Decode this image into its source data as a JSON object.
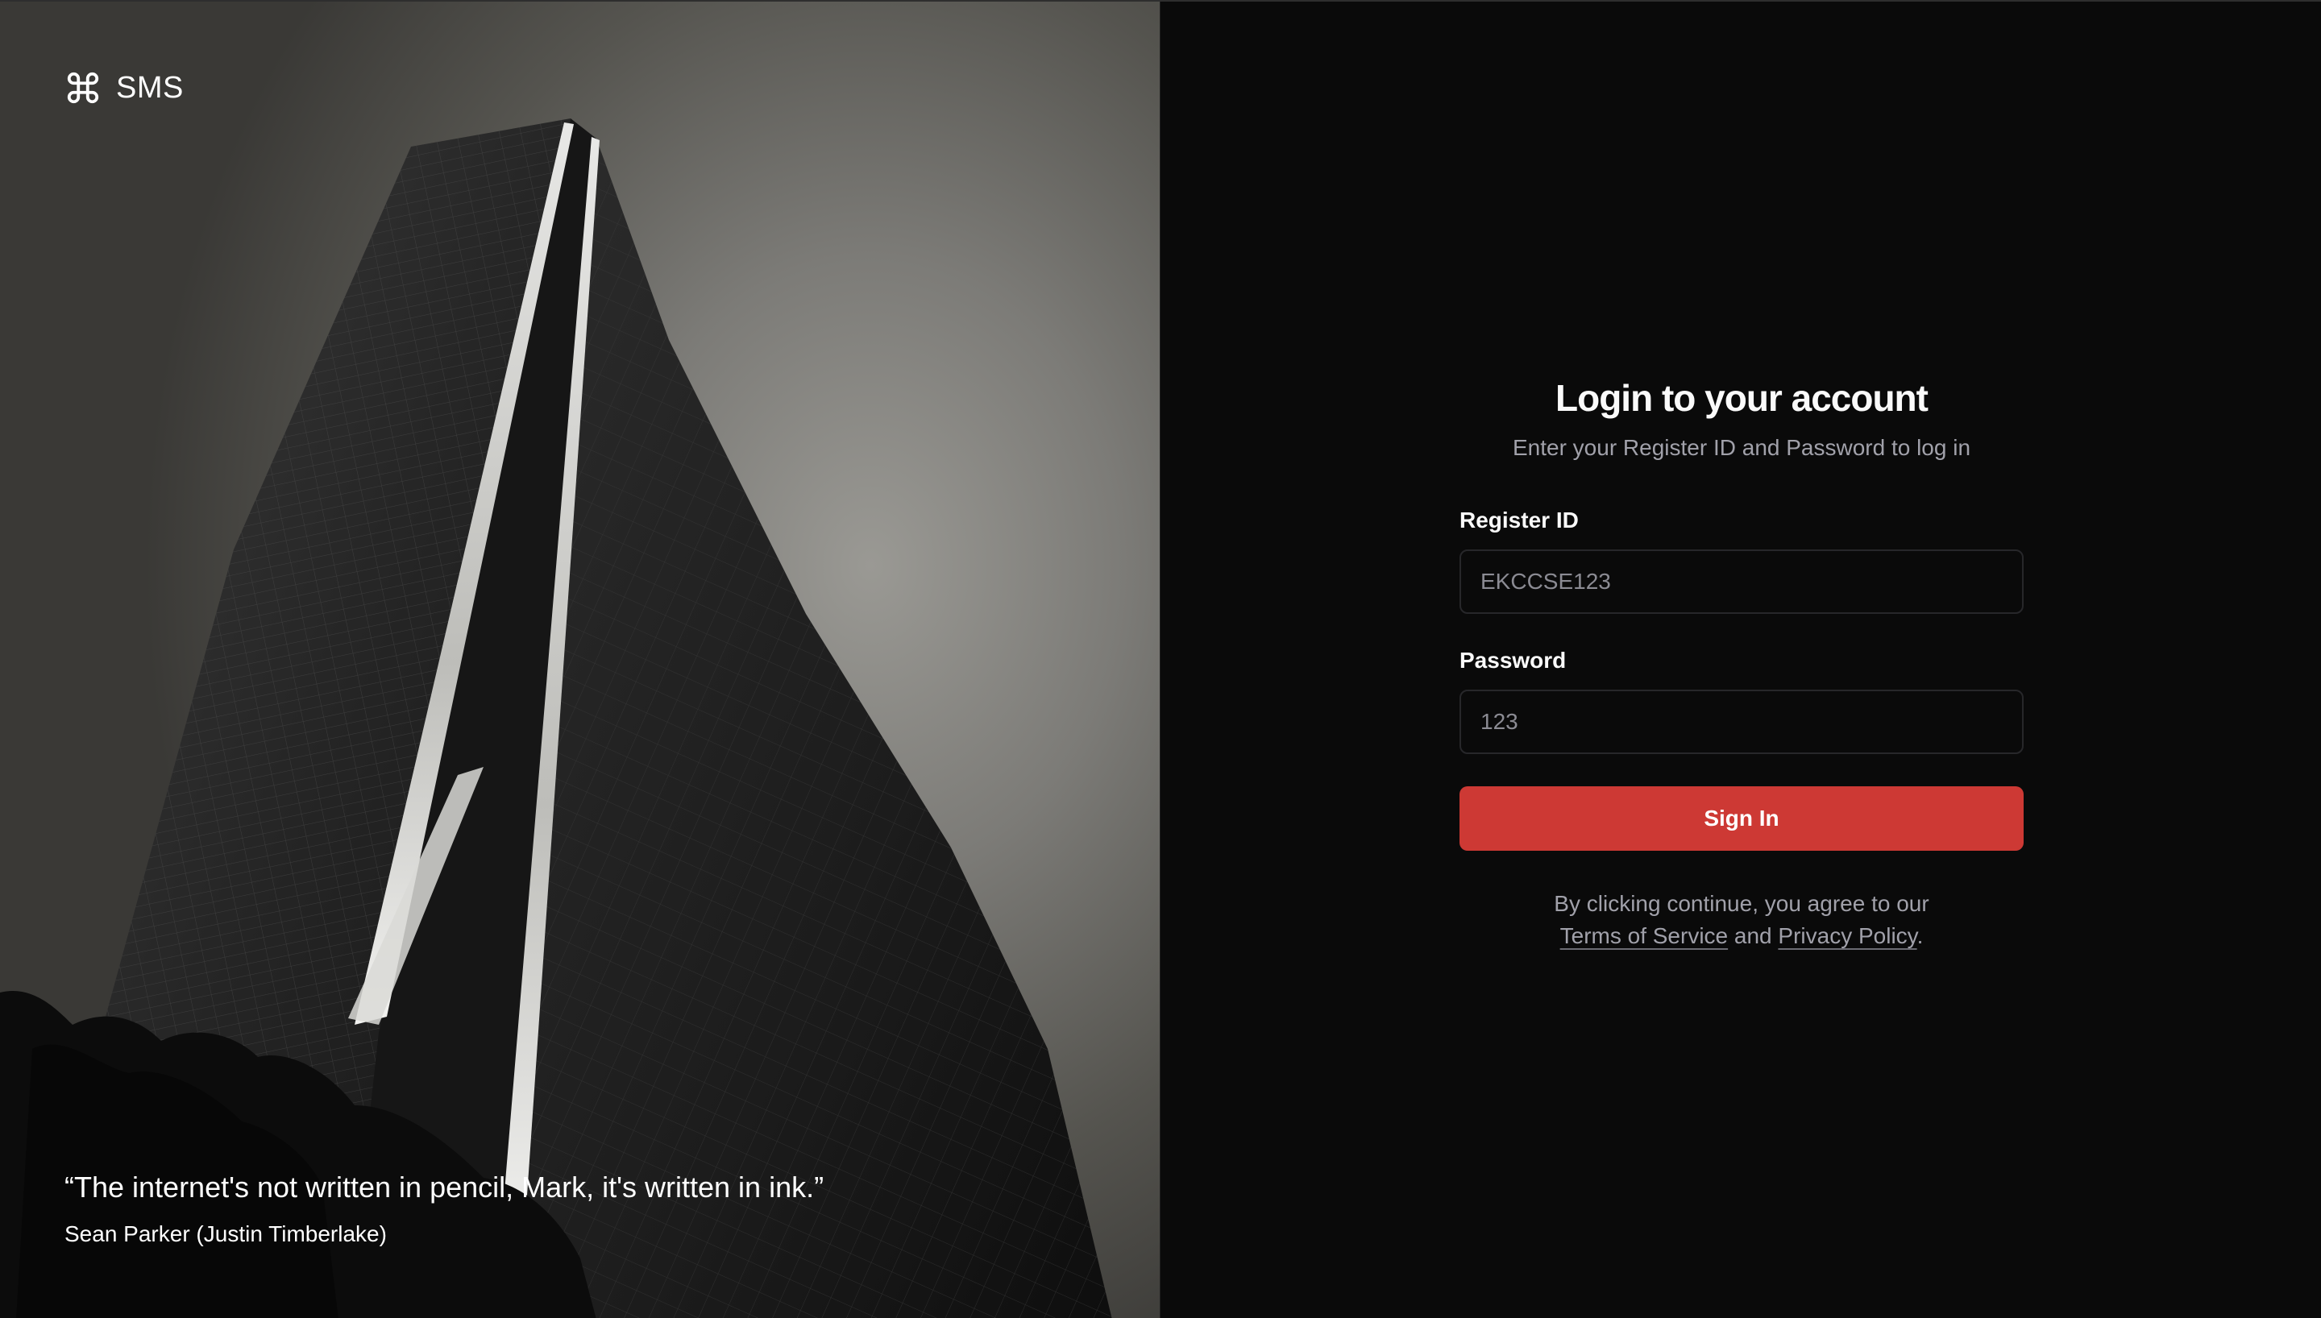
{
  "brand": {
    "icon": "command-icon",
    "name": "SMS"
  },
  "quote": {
    "text": "“The internet's not written in pencil, Mark, it's written in ink.”",
    "author": "Sean Parker (Justin Timberlake)"
  },
  "login": {
    "title": "Login to your account",
    "subtitle": "Enter your Register ID and Password to log in",
    "register_id": {
      "label": "Register ID",
      "placeholder": "EKCCSE123"
    },
    "password": {
      "label": "Password",
      "placeholder": "123"
    },
    "submit_label": "Sign In",
    "legal": {
      "prefix": "By clicking continue, you agree to our",
      "terms": "Terms of Service",
      "and": "and",
      "privacy": "Privacy Policy",
      "suffix": "."
    }
  },
  "colors": {
    "accent": "#cd3934",
    "background": "#0a0a0a",
    "muted_text": "#a1a1aa",
    "input_border": "#27272a"
  }
}
